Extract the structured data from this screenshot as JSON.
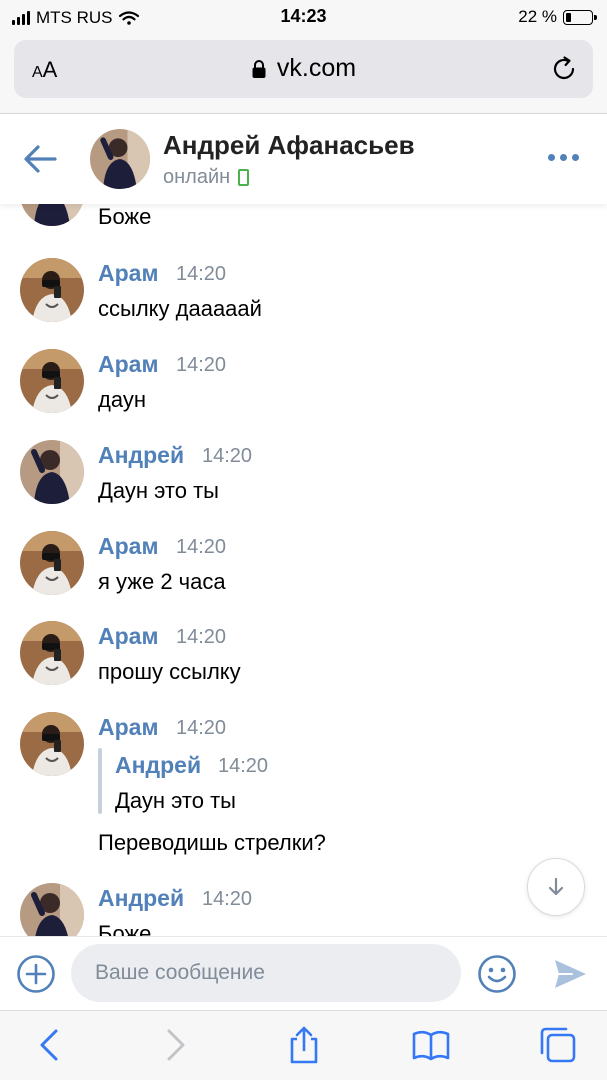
{
  "status_bar": {
    "carrier": "MTS RUS",
    "time": "14:23",
    "battery_percent": "22 %",
    "battery_level": 0.22,
    "icons": [
      "signal-bars-icon",
      "wifi-icon",
      "battery-icon"
    ]
  },
  "browser": {
    "text_size_label": "AA",
    "domain": "vk.com",
    "icons": [
      "lock-icon",
      "reload-icon",
      "back-arrow-icon",
      "forward-arrow-icon",
      "share-icon",
      "bookmarks-icon",
      "tabs-icon"
    ]
  },
  "chat_header": {
    "name": "Андрей Афанасьев",
    "status": "онлайн",
    "icons": [
      "back-arrow-icon",
      "mobile-device-icon",
      "more-dots-icon"
    ]
  },
  "messages": [
    {
      "author": "",
      "time": "",
      "text": "Боже",
      "avatar": "andrey"
    },
    {
      "author": "Арам",
      "time": "14:20",
      "text": "ссылку дааааай",
      "avatar": "aram"
    },
    {
      "author": "Арам",
      "time": "14:20",
      "text": "даун",
      "avatar": "aram"
    },
    {
      "author": "Андрей",
      "time": "14:20",
      "text": "Даун это ты",
      "avatar": "andrey"
    },
    {
      "author": "Арам",
      "time": "14:20",
      "text": "я уже 2 часа",
      "avatar": "aram"
    },
    {
      "author": "Арам",
      "time": "14:20",
      "text": "прошу ссылку",
      "avatar": "aram"
    },
    {
      "author": "Арам",
      "time": "14:20",
      "avatar": "aram",
      "reply": {
        "author": "Андрей",
        "time": "14:20",
        "text": "Даун это ты"
      },
      "text": "Переводишь стрелки?"
    },
    {
      "author": "Андрей",
      "time": "14:20",
      "text": "Боже",
      "avatar": "andrey"
    }
  ],
  "composer": {
    "placeholder": "Ваше сообщение",
    "icons": [
      "attach-plus-icon",
      "emoji-icon",
      "send-icon",
      "scroll-down-icon"
    ]
  },
  "colors": {
    "accent": "#5181b8",
    "secondary_text": "#818c99",
    "online": "#4bb34b",
    "ios_blue": "#3478f6"
  }
}
